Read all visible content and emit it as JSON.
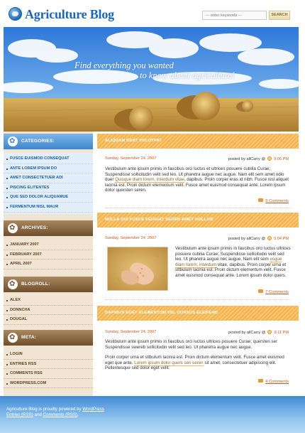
{
  "header": {
    "title": "Agriculture Blog",
    "search": {
      "placeholder": "--- enter keywords ---",
      "button_label": "SEARCH"
    }
  },
  "banner": {
    "slogan_line1": "Find everything you wanted",
    "slogan_line2": "to know about agriculture!"
  },
  "sidebar": {
    "categories": {
      "title": "CATEGORIES:",
      "items": [
        "FUSCE EUISMOD CONSEQUAT",
        "ANTE LOREM IPSUM DO",
        "AMET CONSECTETUER ADI",
        "PISCING ELITENTES",
        "QUE SED DOLOR ALIQUAMUE",
        "FERMENTUM NISL MAUR"
      ]
    },
    "archives": {
      "title": "ARCHIVES:",
      "items": [
        "JANUARY 2007",
        "FEBRUARY 2007",
        "APRIL 2007"
      ]
    },
    "blogroll": {
      "title": "BLOGROLL:",
      "items": [
        "ALEX",
        "DONNCHA",
        "DOUGAL"
      ]
    },
    "meta": {
      "title": "META:",
      "items": [
        "LOGIN",
        "ENTRIES RSS",
        "COMMENTS RSS",
        "WORDPRESS.COM"
      ]
    }
  },
  "posts": [
    {
      "title": "ALIQUAM ERAT VOLUTPAT",
      "date": "Sunday, September 24, 2007",
      "posted_by": "posted by allCarry @",
      "time": "9:06 PM",
      "p1_a": "Vestibulum ante ipsum primis in faucibus orci luctus et ultrices posuere cubilia Curae; Suspendisse sollicitudin velit sed leo. Ut pharetra augue nec augue. Nam elit sem amet odio duer ",
      "p1_link": "Quisque diam lorem, interdum vitae",
      "p1_b": ", dapibus. Proin corper eras id nibh. Fusce nisl aliquet lacinia est. Proin dictum elementum velit. Fusce amet euismod consequat ante. Lorem ipsum dolor quersten seren.",
      "comments": "9 Comments"
    },
    {
      "title": "NULLA DUI FUSCE FEUGIAT SEREN AMET DOLLOR",
      "date": "Sunday, September 24, 2007",
      "posted_by": "posted by allCarry @",
      "time": "5:04 PM",
      "p1_a": "Vestibulum ante ipsum primis in faucibus orci luctus ultrices posuere cubilia Curae; Suspendisse sollicitudin velit sed leo. Ut pharetra augue nec augue. Nam elit sem ",
      "p1_link": "usque diam lorem, interdum",
      "p1_b": " vitae, dapibus. Proin corper urna et sttbulum lacinia est. Proin dictum elementum velit. Fusce amet euismod consequat ante. Lorem ipsum dolor quers.",
      "comments": "7 Comments"
    },
    {
      "title": "DAPIBUS EGET ELEMENTUM VEL CURSUS ELEIFEND",
      "date": "Sunday, September 24, 2007",
      "posted_by": "posted by allCarry @",
      "time": "8:11 PM",
      "p1": "Vestibulum ante ipsum primis in faucibus orci luctus ultrices posuere Curae; quersten ser Suspendisse swereb sollicitudin velit sed leo. Ut pharetra augue nec augue.",
      "p2_a": "Proin corper urna et sttbulum lacinia est. Proin dictum elementum velit. Fusce amet euismod eget que ante. ",
      "p2_link": "Lorem ipsum dolor quers sen seren",
      "p2_b": " sit amet, consectetuer adipiscing elit. Pellentesque sed dolor eget velit.",
      "comments": "4 Comments"
    }
  ],
  "footer": {
    "line1_text": "Agriculture Blog is proudly powered by ",
    "line1_link": "WordPress",
    "line2_link1": "Entries (RSS)",
    "line2_and": " and ",
    "line2_link2": "Comments (RSS)",
    "line2_end": "."
  }
}
